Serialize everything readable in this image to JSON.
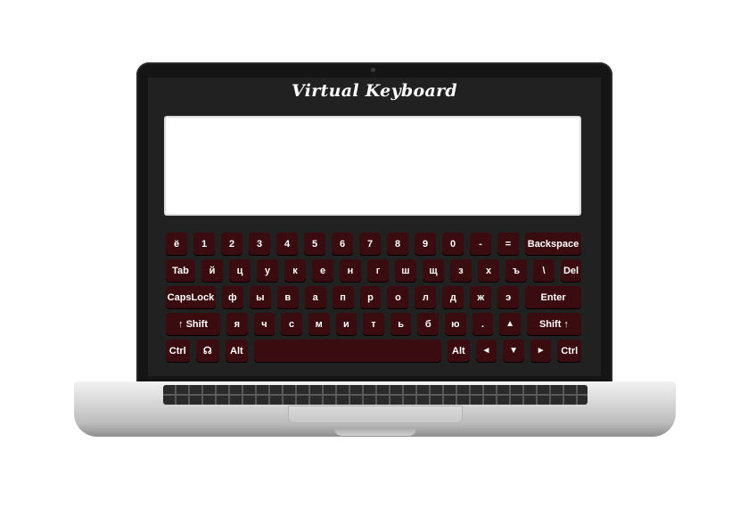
{
  "app": {
    "title": "Virtual Keyboard"
  },
  "textarea": {
    "value": "",
    "placeholder": ""
  },
  "keyboard": {
    "row1": [
      "ё",
      "1",
      "2",
      "3",
      "4",
      "5",
      "6",
      "7",
      "8",
      "9",
      "0",
      "-",
      "=",
      "Backspace"
    ],
    "row2": [
      "Tab",
      "й",
      "ц",
      "у",
      "к",
      "е",
      "н",
      "г",
      "ш",
      "щ",
      "з",
      "х",
      "ъ",
      "\\",
      "Del"
    ],
    "row3": [
      "CapsLock",
      "ф",
      "ы",
      "в",
      "а",
      "п",
      "р",
      "о",
      "л",
      "д",
      "ж",
      "э",
      "Enter"
    ],
    "row4": [
      "↑ Shift",
      "я",
      "ч",
      "с",
      "м",
      "и",
      "т",
      "ь",
      "б",
      "ю",
      ".",
      "▲",
      "Shift ↑"
    ],
    "row5": [
      "Ctrl",
      "☊",
      "Alt",
      "",
      "Alt",
      "◄",
      "▼",
      "►",
      "Ctrl"
    ]
  },
  "colors": {
    "key_bg": "#3a0c10",
    "screen_bg": "#212121",
    "key_text": "#ffffff"
  },
  "icons": {
    "language_key": "language-switch-icon",
    "arrow_up": "arrow-up-icon",
    "arrow_left": "arrow-left-icon",
    "arrow_down": "arrow-down-icon",
    "arrow_right": "arrow-right-icon"
  }
}
